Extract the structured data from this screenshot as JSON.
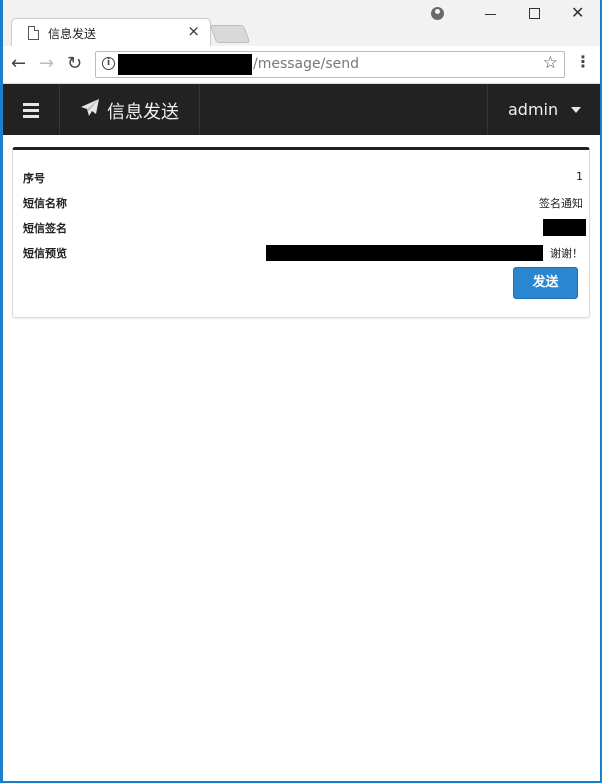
{
  "browser": {
    "tab_title": "信息发送",
    "tab_close": "×",
    "url_path": "/message/send"
  },
  "navbar": {
    "brand": "信息发送",
    "user": "admin"
  },
  "details": {
    "rows": [
      {
        "label": "序号",
        "value": "1"
      },
      {
        "label": "短信名称",
        "value": "签名通知"
      },
      {
        "label": "短信签名",
        "value": ""
      },
      {
        "label": "短信预览",
        "value": "谢谢！"
      }
    ]
  },
  "actions": {
    "send_label": "发送"
  },
  "colors": {
    "navbar_bg": "#222222",
    "primary_button": "#2a86cf"
  }
}
